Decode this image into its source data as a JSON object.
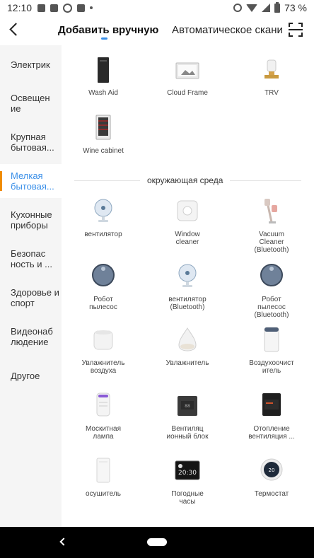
{
  "status_bar": {
    "time": "12:10",
    "battery": "73 %"
  },
  "header": {
    "tab_manual": "Добавить вручную",
    "tab_auto": "Автоматическое скани"
  },
  "sidebar": {
    "items": [
      {
        "label": "Электрик"
      },
      {
        "label": "Освещен ие"
      },
      {
        "label": "Крупная бытовая..."
      },
      {
        "label": "Мелкая бытовая..."
      },
      {
        "label": "Кухонные приборы"
      },
      {
        "label": "Безопас ность и ..."
      },
      {
        "label": "Здоровье и спорт"
      },
      {
        "label": "Видеонаб людение"
      },
      {
        "label": "Другое"
      }
    ],
    "active_index": 3
  },
  "top_devices": [
    {
      "name": "Wash Aid",
      "icon": "wash-aid-icon"
    },
    {
      "name": "Cloud Frame",
      "icon": "cloud-frame-icon"
    },
    {
      "name": "TRV",
      "icon": "trv-icon"
    },
    {
      "name": "Wine cabinet",
      "icon": "wine-cabinet-icon"
    }
  ],
  "section": {
    "title": "окружающая среда"
  },
  "env_devices": [
    {
      "name": "вентилятор",
      "icon": "fan-icon"
    },
    {
      "name": "Window cleaner",
      "icon": "window-cleaner-icon"
    },
    {
      "name": "Vacuum Cleaner (Bluetooth)",
      "icon": "vacuum-cleaner-icon"
    },
    {
      "name": "Робот пылесос",
      "icon": "robot-vacuum-icon"
    },
    {
      "name": "вентилятор (Bluetooth)",
      "icon": "fan-bluetooth-icon"
    },
    {
      "name": "Робот пылесос (Bluetooth)",
      "icon": "robot-vacuum-bluetooth-icon"
    },
    {
      "name": "Увлажнитель воздуха",
      "icon": "air-humidifier-icon"
    },
    {
      "name": "Увлажнитель",
      "icon": "humidifier-icon"
    },
    {
      "name": "Воздухоочист итель",
      "icon": "air-purifier-icon"
    },
    {
      "name": "Москитная лампа",
      "icon": "mosquito-lamp-icon"
    },
    {
      "name": "Вентиляц ионный блок",
      "icon": "ventilation-unit-icon"
    },
    {
      "name": "Отопление вентиляция ...",
      "icon": "hvac-icon"
    },
    {
      "name": "осушитель",
      "icon": "dehumidifier-icon"
    },
    {
      "name": "Погодные часы",
      "icon": "weather-clock-icon"
    },
    {
      "name": "Термостат",
      "icon": "thermostat-icon"
    }
  ],
  "colors": {
    "accent": "#3a8fe8",
    "active_marker": "#f08c00"
  }
}
